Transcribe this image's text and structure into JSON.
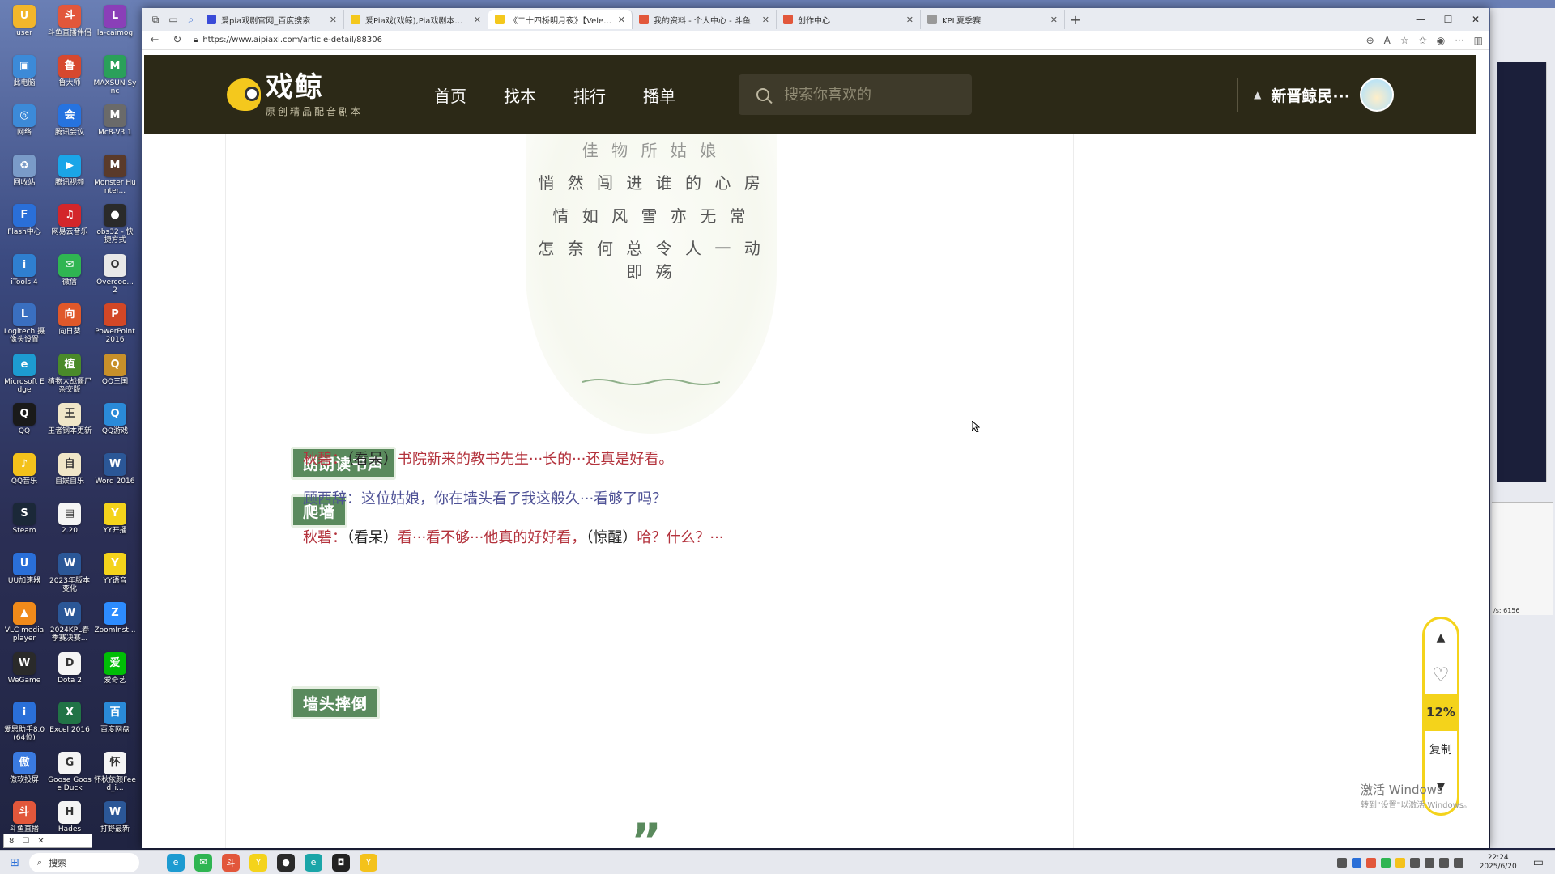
{
  "desktop_icons": [
    {
      "label": "user",
      "color": "#f2b62b",
      "glyph": "U"
    },
    {
      "label": "斗鱼直播伴侣",
      "color": "#e2573b",
      "glyph": "斗"
    },
    {
      "label": "la-caimog",
      "color": "#8a3fb8",
      "glyph": "L"
    },
    {
      "label": "此电脑",
      "color": "#3c8ad8",
      "glyph": "▣"
    },
    {
      "label": "鲁大师",
      "color": "#d6482f",
      "glyph": "鲁"
    },
    {
      "label": "MAXSUN Sync",
      "color": "#2aa05a",
      "glyph": "M"
    },
    {
      "label": "网络",
      "color": "#3c8ad8",
      "glyph": "◎"
    },
    {
      "label": "腾讯会议",
      "color": "#2673e0",
      "glyph": "会"
    },
    {
      "label": "Mc8-V3.1",
      "color": "#6a6a6a",
      "glyph": "M"
    },
    {
      "label": "回收站",
      "color": "#7a9bc8",
      "glyph": "♻"
    },
    {
      "label": "腾讯视频",
      "color": "#1aa5e8",
      "glyph": "▶"
    },
    {
      "label": "Monster Hunter...",
      "color": "#5a3a2a",
      "glyph": "M"
    },
    {
      "label": "Flash中心",
      "color": "#2a6fd8",
      "glyph": "F"
    },
    {
      "label": "网易云音乐",
      "color": "#d3262b",
      "glyph": "♫"
    },
    {
      "label": "obs32 - 快捷方式",
      "color": "#2a2a2a",
      "glyph": "●"
    },
    {
      "label": "iTools 4",
      "color": "#2f7fd0",
      "glyph": "i"
    },
    {
      "label": "微信",
      "color": "#2fb552",
      "glyph": "✉"
    },
    {
      "label": "Overcoo... 2",
      "color": "#e8e8e8",
      "glyph": "O"
    },
    {
      "label": "Logitech 摄像头设置",
      "color": "#3a6fc0",
      "glyph": "L"
    },
    {
      "label": "向日葵",
      "color": "#e0582a",
      "glyph": "向"
    },
    {
      "label": "PowerPoint 2016",
      "color": "#d24726",
      "glyph": "P"
    },
    {
      "label": "Microsoft Edge",
      "color": "#1d9bd1",
      "glyph": "e"
    },
    {
      "label": "植物大战僵尸杂交版",
      "color": "#4a8a2a",
      "glyph": "植"
    },
    {
      "label": "QQ三国",
      "color": "#c8902a",
      "glyph": "Q"
    },
    {
      "label": "QQ",
      "color": "#1a1a1a",
      "glyph": "Q"
    },
    {
      "label": "王者钢本更新",
      "color": "#f0e6c8",
      "glyph": "王"
    },
    {
      "label": "QQ游戏",
      "color": "#2a8ad8",
      "glyph": "Q"
    },
    {
      "label": "QQ音乐",
      "color": "#f4c21b",
      "glyph": "♪"
    },
    {
      "label": "自娱自乐",
      "color": "#f0e6c8",
      "glyph": "自"
    },
    {
      "label": "Word 2016",
      "color": "#2b5797",
      "glyph": "W"
    },
    {
      "label": "Steam",
      "color": "#1b2838",
      "glyph": "S"
    },
    {
      "label": "2.20",
      "color": "#f4f4f4",
      "glyph": "▤"
    },
    {
      "label": "YY开播",
      "color": "#f4d31b",
      "glyph": "Y"
    },
    {
      "label": "UU加速器",
      "color": "#2a6fd8",
      "glyph": "U"
    },
    {
      "label": "2023年版本变化",
      "color": "#2b5797",
      "glyph": "W"
    },
    {
      "label": "YY语音",
      "color": "#f4d31b",
      "glyph": "Y"
    },
    {
      "label": "VLC media player",
      "color": "#f08a1a",
      "glyph": "▲"
    },
    {
      "label": "2024KPL春季赛决赛...",
      "color": "#2b5797",
      "glyph": "W"
    },
    {
      "label": "ZoomInst...",
      "color": "#2d8cff",
      "glyph": "Z"
    },
    {
      "label": "WeGame",
      "color": "#2a2a2a",
      "glyph": "W"
    },
    {
      "label": "Dota 2",
      "color": "#f4f4f4",
      "glyph": "D"
    },
    {
      "label": "爱奇艺",
      "color": "#00be06",
      "glyph": "爱"
    },
    {
      "label": "爱思助手8.0(64位)",
      "color": "#2a6fd8",
      "glyph": "i"
    },
    {
      "label": "Excel 2016",
      "color": "#217346",
      "glyph": "X"
    },
    {
      "label": "百度网盘",
      "color": "#2a8ad8",
      "glyph": "百"
    },
    {
      "label": "傲软投屏",
      "color": "#3a7ae0",
      "glyph": "傲"
    },
    {
      "label": "Goose Goose Duck",
      "color": "#f4f4f4",
      "glyph": "G"
    },
    {
      "label": "怀秋依颜Feed_i...",
      "color": "#f4f4f4",
      "glyph": "怀"
    },
    {
      "label": "斗鱼直播",
      "color": "#e2573b",
      "glyph": "斗"
    },
    {
      "label": "Hades",
      "color": "#f4f4f4",
      "glyph": "H"
    },
    {
      "label": "打野最新",
      "color": "#2b5797",
      "glyph": "W"
    }
  ],
  "browser": {
    "tabs": [
      {
        "title": "爱pia戏剧官网_百度搜索",
        "active": false,
        "color": "#3a4bd8"
      },
      {
        "title": "爱Pia戏(戏鲸),Pia戏剧本网,广播剧",
        "active": false,
        "color": "#f4c81d"
      },
      {
        "title": "《二十四桥明月夜》【Velement】",
        "active": true,
        "color": "#f4c81d"
      },
      {
        "title": "我的资料 - 个人中心 - 斗鱼",
        "active": false,
        "color": "#e2573b"
      },
      {
        "title": "创作中心",
        "active": false,
        "color": "#e2573b"
      },
      {
        "title": "KPL夏季赛",
        "active": false,
        "color": "#999999"
      }
    ],
    "url": "https://www.aipiaxi.com/article-detail/88306"
  },
  "site": {
    "logo_name": "戏鲸",
    "logo_slogan": "原创精品配音剧本",
    "nav": [
      "首页",
      "找本",
      "排行",
      "播单"
    ],
    "search_placeholder": "搜索你喜欢的",
    "username": "新晋鲸民···"
  },
  "poem": [
    "佳 物 所 姑 娘",
    "悄 然 闯 进 谁 的 心 房",
    "情 如 风 雪 亦 无 常",
    "怎 奈 何 总 令 人 一 动 即 殇"
  ],
  "tags": [
    "朗朗读书声",
    "爬墙",
    "墙头摔倒"
  ],
  "dialog": [
    {
      "speaker": "秋碧：",
      "parts": [
        {
          "t": "（看呆）",
          "k": "narr"
        },
        {
          "t": "书院新来的教书先生···长的···还真是好看。",
          "k": "sp-qb"
        }
      ],
      "cls": "sp-qb"
    },
    {
      "speaker": "顾西辞：",
      "parts": [
        {
          "t": "这位姑娘，你在墙头看了我这般久···看够了吗？",
          "k": "sp-gx"
        }
      ],
      "cls": "sp-gx"
    },
    {
      "speaker": "秋碧：",
      "parts": [
        {
          "t": "（看呆）",
          "k": "narr"
        },
        {
          "t": "看···看不够···他真的好好看，",
          "k": "sp-qb"
        },
        {
          "t": "（惊醒）",
          "k": "narr"
        },
        {
          "t": "哈？什么？···",
          "k": "sp-qb"
        }
      ],
      "cls": "sp-qb"
    }
  ],
  "floatbar": {
    "percent": "12%",
    "copy": "复制"
  },
  "watermark": {
    "title": "激活 Windows",
    "sub": "转到\"设置\"以激活 Windows。"
  },
  "rightwin": {
    "speed": "/s: 6156"
  },
  "taskbar": {
    "search": "搜索",
    "time": "22:24",
    "date": "2025/6/20"
  },
  "tinywin": {
    "label": "8"
  }
}
